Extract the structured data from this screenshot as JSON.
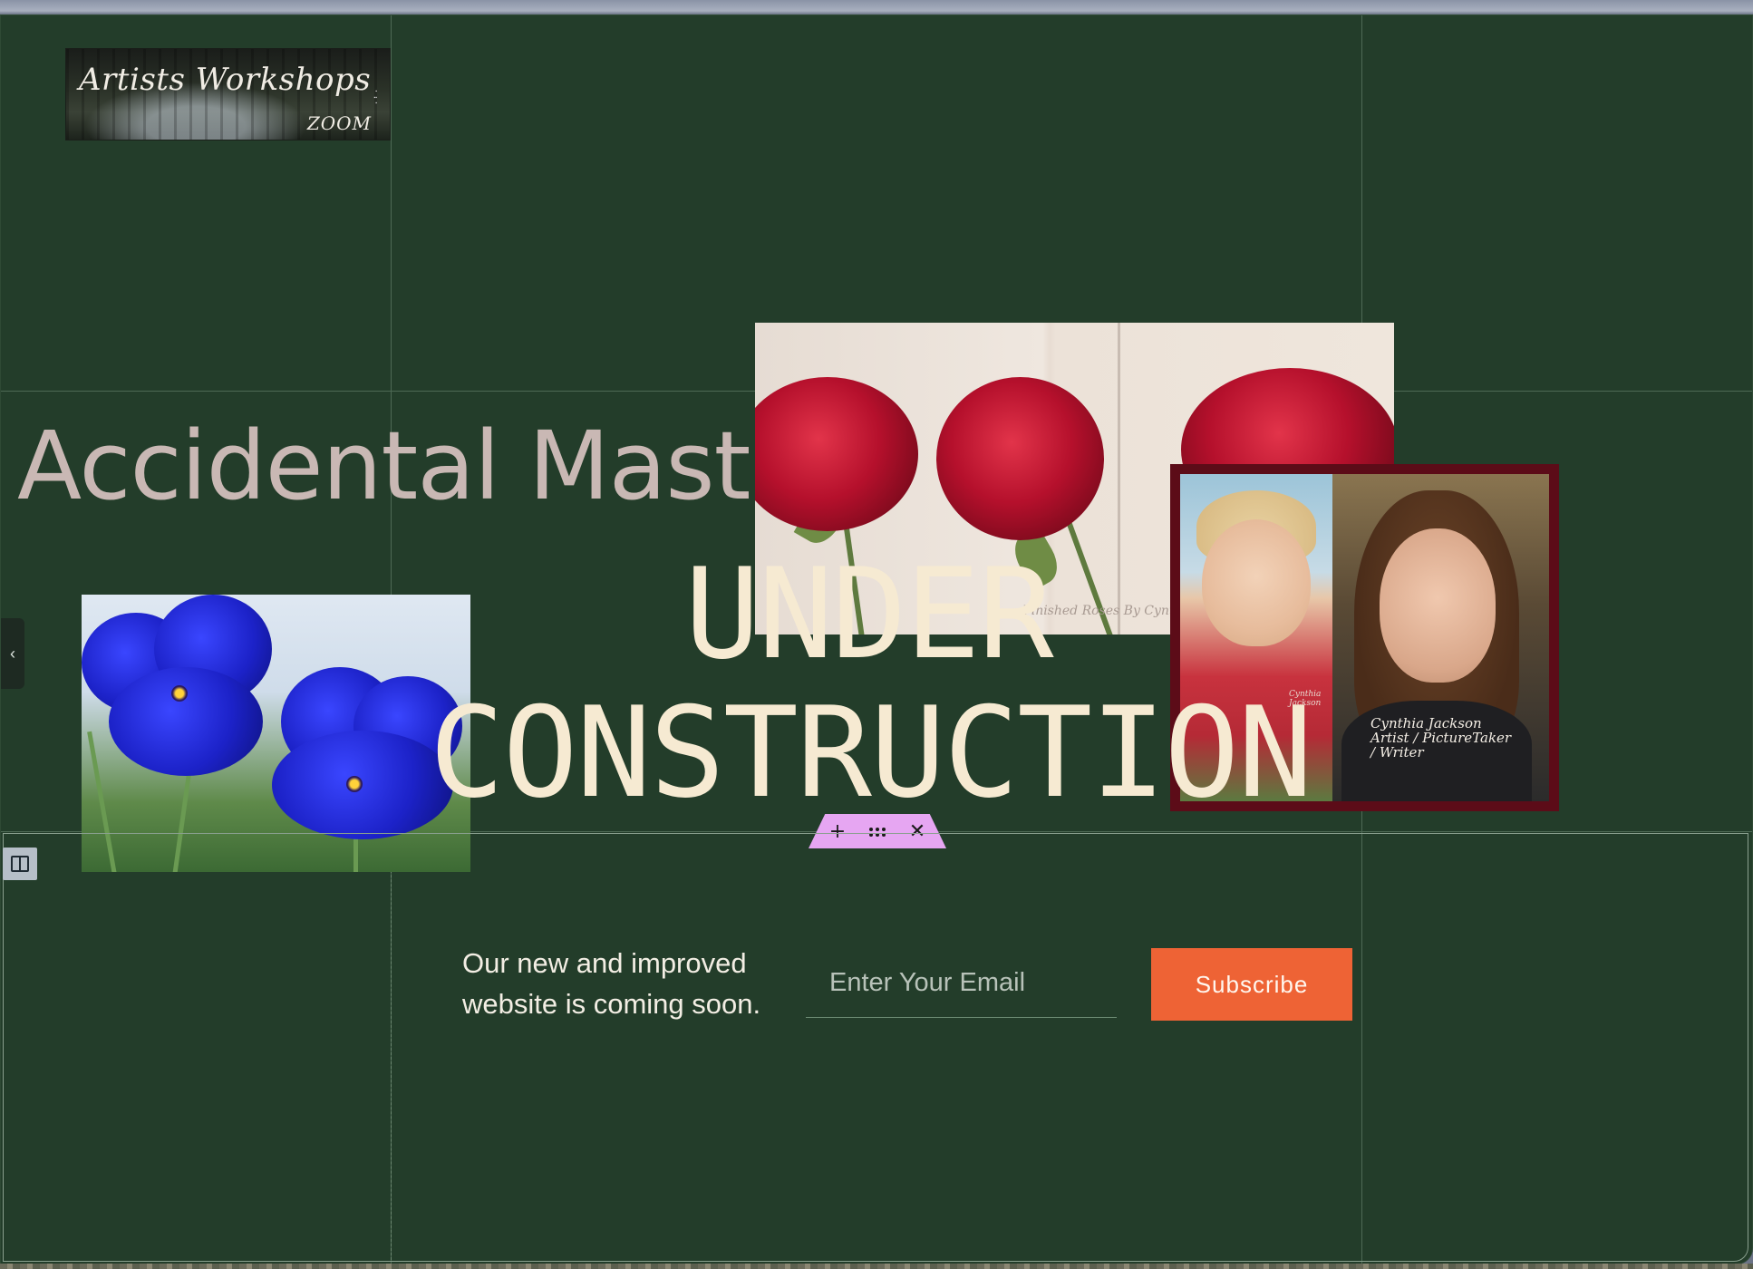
{
  "site": {
    "logo": {
      "title": "Artists Workshops",
      "subtitle": "ZOOM"
    },
    "headline": "Accidental Masterp"
  },
  "artwork": {
    "roses_caption": "Finished Roses By Cynthia",
    "portrait_caption": "Cynthia Jackson Artist / PictureTaker / Writer",
    "child_signature": "Cynthia Jackson"
  },
  "hero": {
    "line1": "UNDER",
    "line2": "CONSTRUCTION"
  },
  "editor": {
    "toolbar": {
      "add_label": "+",
      "close_label": "✕"
    },
    "left_tab_label": "‹"
  },
  "subscribe": {
    "tagline": "Our new and improved website is coming soon.",
    "email_placeholder": "Enter Your Email",
    "button_label": "Subscribe"
  },
  "colors": {
    "background": "#233d2a",
    "headline": "#c9b8b4",
    "hero_text": "#f6ead2",
    "accent": "#ee6335",
    "toolbar": "#e6a6f2",
    "portrait_frame": "#5c0c18"
  }
}
